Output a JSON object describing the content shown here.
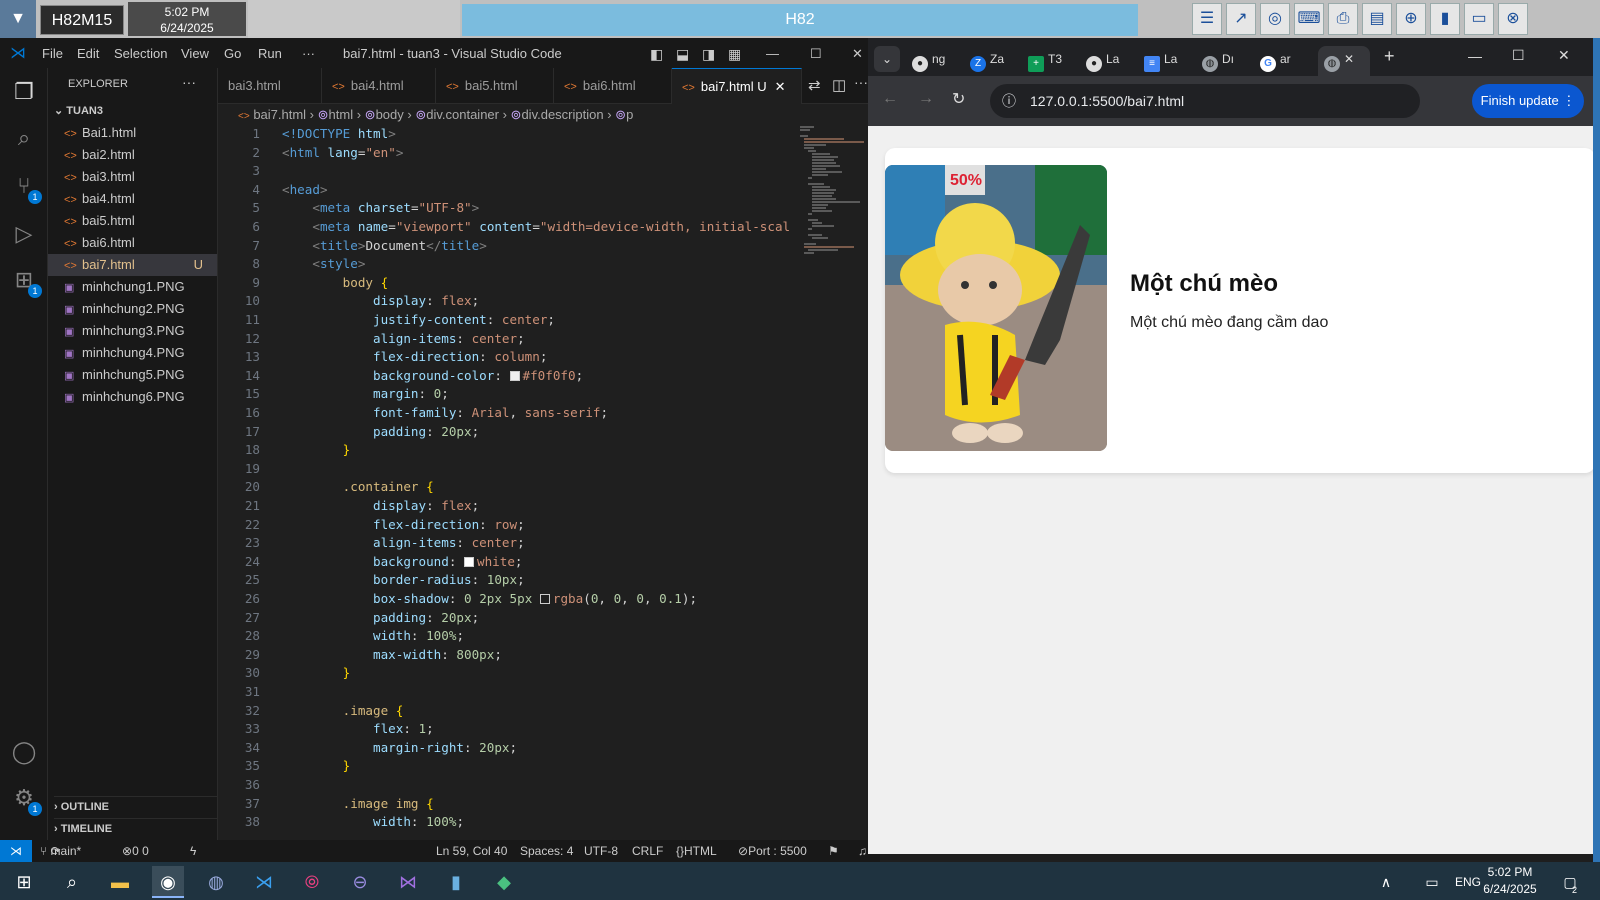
{
  "topstrip": {
    "host": "H82M15",
    "time": "5:02 PM",
    "date": "6/24/2025",
    "banner": "H82"
  },
  "vscode": {
    "menu": [
      "File",
      "Edit",
      "Selection",
      "View",
      "Go",
      "Run",
      "···"
    ],
    "window_title": "bai7.html - tuan3 - Visual Studio Code",
    "explorer": {
      "header": "EXPLORER",
      "folder": "TUAN3",
      "files": [
        {
          "name": "Bai1.html",
          "type": "html"
        },
        {
          "name": "bai2.html",
          "type": "html"
        },
        {
          "name": "bai3.html",
          "type": "html"
        },
        {
          "name": "bai4.html",
          "type": "html"
        },
        {
          "name": "bai5.html",
          "type": "html"
        },
        {
          "name": "bai6.html",
          "type": "html"
        },
        {
          "name": "bai7.html",
          "type": "html",
          "status": "U"
        },
        {
          "name": "minhchung1.PNG",
          "type": "png"
        },
        {
          "name": "minhchung2.PNG",
          "type": "png"
        },
        {
          "name": "minhchung3.PNG",
          "type": "png"
        },
        {
          "name": "minhchung4.PNG",
          "type": "png"
        },
        {
          "name": "minhchung5.PNG",
          "type": "png"
        },
        {
          "name": "minhchung6.PNG",
          "type": "png"
        }
      ],
      "outline": "OUTLINE",
      "timeline": "TIMELINE"
    },
    "tabs": [
      "bai3.html",
      "bai4.html",
      "bai5.html",
      "bai6.html",
      "bai7.html U"
    ],
    "breadcrumb": [
      "bai7.html",
      "html",
      "body",
      "div.container",
      "div.description",
      "p"
    ],
    "status": {
      "branch": "main*",
      "problems": "0 0",
      "position": "Ln 59, Col 40",
      "spaces": "Spaces: 4",
      "encoding": "UTF-8",
      "eol": "CRLF",
      "language": "HTML",
      "port": "Port : 5500"
    }
  },
  "chrome": {
    "tabs": [
      "ng",
      "Za",
      "T3",
      "La",
      "La",
      "Dı",
      "ar",
      ""
    ],
    "url": "127.0.0.1:5500/bai7.html",
    "update_button": "Finish update",
    "page": {
      "title": "Một chú mèo",
      "description": "Một chú mèo đang cầm dao"
    }
  },
  "taskbar": {
    "lang": "ENG",
    "time": "5:02 PM",
    "date": "6/24/2025",
    "notifications": "2"
  }
}
